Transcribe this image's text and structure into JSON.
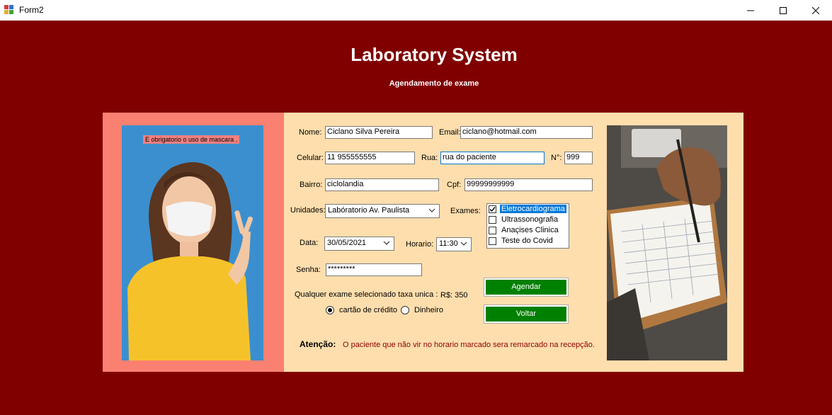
{
  "window": {
    "title": "Form2"
  },
  "header": {
    "title": "Laboratory System",
    "subtitle": "Agendamento de exame"
  },
  "left_panel": {
    "mask_notice": "E obrigatorio o uso de mascara ."
  },
  "form": {
    "nome": {
      "label": "Nome:",
      "value": "Ciclano Silva Pereira"
    },
    "email": {
      "label": "Email:",
      "value": "ciclano@hotmail.com"
    },
    "celular": {
      "label": "Celular:",
      "value": "11 955555555"
    },
    "rua": {
      "label": "Rua:",
      "value": "rua do paciente"
    },
    "numero": {
      "label": "N°:",
      "value": "999"
    },
    "bairro": {
      "label": "Bairro:",
      "value": "ciclolandia"
    },
    "cpf": {
      "label": "Cpf:",
      "value": "99999999999"
    },
    "unidades": {
      "label": "Unidades:",
      "value": "Labóratorio Av. Paulista"
    },
    "exames": {
      "label": "Exames:",
      "items": [
        {
          "label": "Eletrocardiograma",
          "checked": true,
          "selected": true
        },
        {
          "label": "Ultrassonografia",
          "checked": false,
          "selected": false
        },
        {
          "label": "Anaçises Clinica",
          "checked": false,
          "selected": false
        },
        {
          "label": "Teste do Covid",
          "checked": false,
          "selected": false
        }
      ]
    },
    "data": {
      "label": "Data:",
      "value": "30/05/2021"
    },
    "horario": {
      "label": "Horario:",
      "value": "11:30"
    },
    "senha": {
      "label": "Senha:",
      "value": "*********"
    },
    "taxa": {
      "label": "Qualquer exame selecionado taxa unica :",
      "value": "R$: 350"
    },
    "pagamento": [
      {
        "label": "cartão de crédito",
        "selected": true
      },
      {
        "label": "Dinheiro",
        "selected": false
      }
    ],
    "agendar_label": "Agendar",
    "voltar_label": "Voltar",
    "atencao": {
      "label": "Atenção:",
      "message": "O paciente que não vir no horario marcado sera remarcado na recepção."
    }
  },
  "colors": {
    "background": "#800000",
    "form_bg": "#ffdead",
    "left_panel": "#fa8072",
    "button": "#008000",
    "warning_text": "#8b0000",
    "selection": "#0078d7"
  }
}
